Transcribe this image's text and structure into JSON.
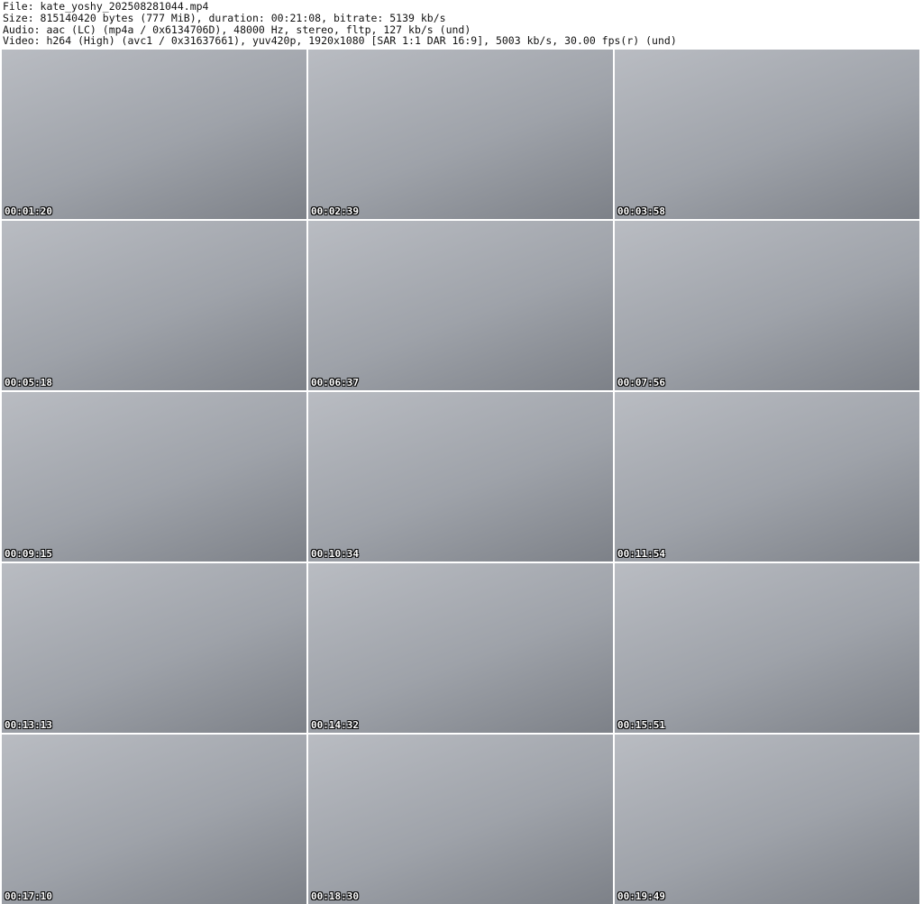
{
  "header": {
    "file": "File: kate_yoshy_202508281044.mp4",
    "size": "Size: 815140420 bytes (777 MiB), duration: 00:21:08, bitrate: 5139 kb/s",
    "audio": "Audio: aac (LC) (mp4a / 0x6134706D), 48000 Hz, stereo, fltp, 127 kb/s (und)",
    "video": "Video: h264 (High) (avc1 / 0x31637661), yuv420p, 1920x1080 [SAR 1:1 DAR 16:9], 5003 kb/s, 30.00 fps(r) (und)"
  },
  "thumbnails": [
    "00:01:20",
    "00:02:39",
    "00:03:58",
    "00:05:18",
    "00:06:37",
    "00:07:56",
    "00:09:15",
    "00:10:34",
    "00:11:54",
    "00:13:13",
    "00:14:32",
    "00:15:51",
    "00:17:10",
    "00:18:30",
    "00:19:49"
  ]
}
